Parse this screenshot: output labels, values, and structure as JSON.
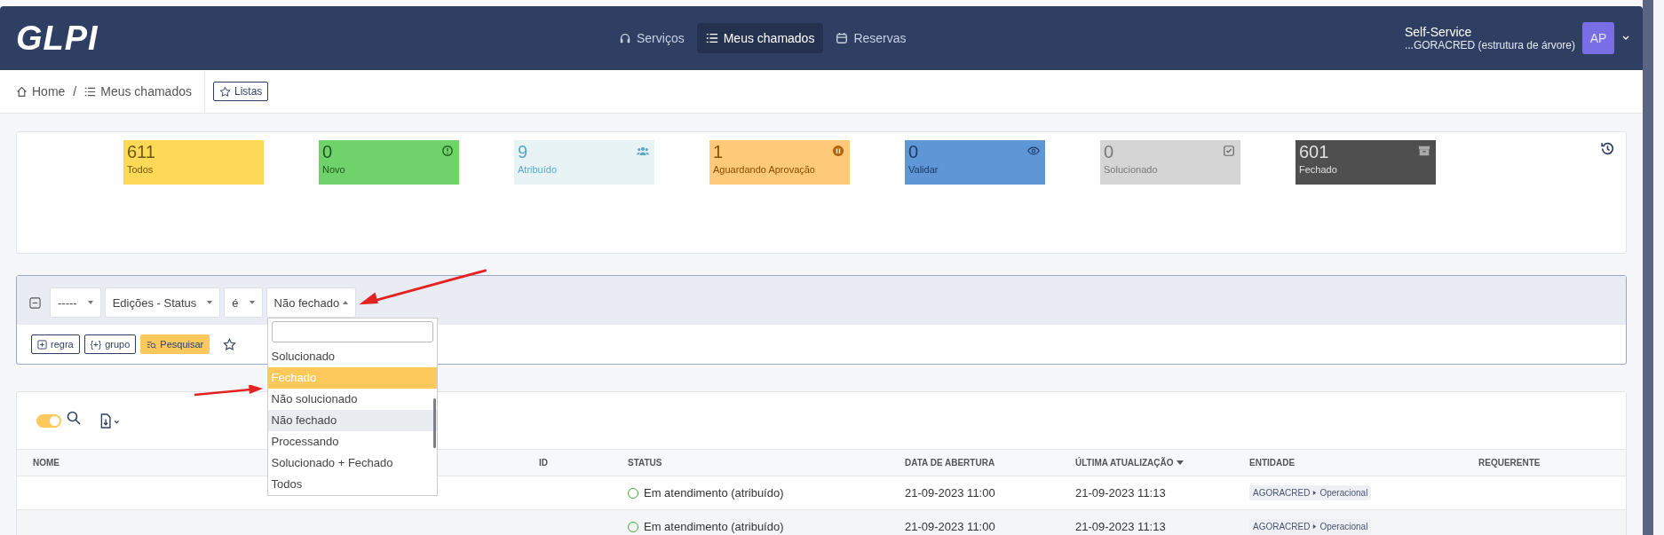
{
  "header": {
    "logo": "GLPI",
    "nav": [
      {
        "label": "Serviços",
        "kind": "headset",
        "selected": false
      },
      {
        "label": "Meus chamados",
        "kind": "list",
        "selected": true
      },
      {
        "label": "Reservas",
        "kind": "calendar",
        "selected": false
      }
    ],
    "profile": "Self-Service",
    "entity": "...GORACRED (estrutura de árvore)",
    "avatar": "AP"
  },
  "breadcrumb": {
    "items": [
      {
        "label": "Home",
        "kind": "home"
      },
      {
        "label": "Meus chamados",
        "kind": "list"
      }
    ],
    "separator": "/",
    "lists_button": "Listas"
  },
  "stats": [
    {
      "count": "611",
      "label": "Todos",
      "kind": "all",
      "color": "#ffd957"
    },
    {
      "count": "0",
      "label": "Novo",
      "kind": "new",
      "color": "#6fd26a"
    },
    {
      "count": "9",
      "label": "Atribuído",
      "kind": "assigned",
      "color": "#e8f3f6"
    },
    {
      "count": "1",
      "label": "Aguardando Aprovação",
      "kind": "waiting",
      "color": "#ffc97a"
    },
    {
      "count": "0",
      "label": "Validar",
      "kind": "validate",
      "color": "#5f97d6"
    },
    {
      "count": "0",
      "label": "Solucionado",
      "kind": "solved",
      "color": "#d5d5d5"
    },
    {
      "count": "601",
      "label": "Fechado",
      "kind": "closed",
      "color": "#4f4f4f"
    }
  ],
  "filter": {
    "selects": [
      {
        "value": "-----",
        "open": false
      },
      {
        "value": "Edições - Status",
        "open": false
      },
      {
        "value": "é",
        "open": false
      },
      {
        "value": "Não fechado",
        "open": true
      }
    ],
    "buttons": [
      {
        "label": "regra",
        "kind": "rule"
      },
      {
        "label": "grupo",
        "kind": "group",
        "icon": "{+}"
      },
      {
        "label": "Pesquisar",
        "kind": "search"
      }
    ],
    "dropdown": [
      {
        "label": "Solucionado",
        "selected": false,
        "highlighted": false
      },
      {
        "label": "Fechado",
        "selected": false,
        "highlighted": true
      },
      {
        "label": "Não solucionado",
        "selected": false,
        "highlighted": false
      },
      {
        "label": "Não fechado",
        "selected": true,
        "highlighted": false
      },
      {
        "label": "Processando",
        "selected": false,
        "highlighted": false
      },
      {
        "label": "Solucionado + Fechado",
        "selected": false,
        "highlighted": false
      },
      {
        "label": "Todos",
        "selected": false,
        "highlighted": false
      }
    ]
  },
  "table": {
    "toggle_on": true,
    "columns": [
      {
        "label": "NOME",
        "sorted": false
      },
      {
        "label": "ID",
        "sorted": false
      },
      {
        "label": "STATUS",
        "sorted": false
      },
      {
        "label": "DATA DE ABERTURA",
        "sorted": false
      },
      {
        "label": "ÚLTIMA ATUALIZAÇÃO",
        "sorted": true
      },
      {
        "label": "ENTIDADE",
        "sorted": false
      },
      {
        "label": "REQUERENTE",
        "sorted": false
      }
    ],
    "rows": [
      {
        "status": "Em atendimento (atribuído)",
        "opened": "21-09-2023 11:00",
        "updated": "21-09-2023 11:13",
        "entity": "AGORACRED",
        "entity_sub": "Operacional"
      },
      {
        "status": "Em atendimento (atribuído)",
        "opened": "21-09-2023 11:00",
        "updated": "21-09-2023 11:13",
        "entity": "AGORACRED",
        "entity_sub": "Operacional"
      }
    ]
  }
}
